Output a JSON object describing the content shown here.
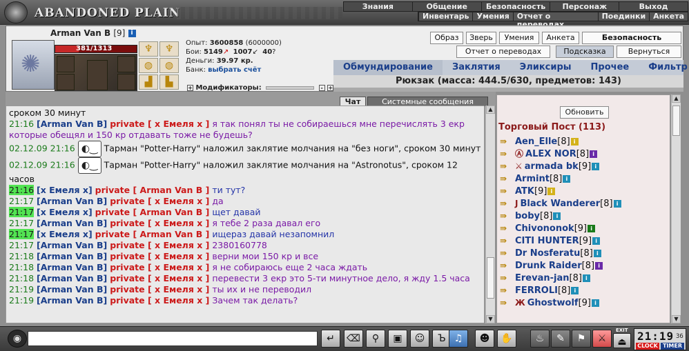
{
  "app": {
    "logo": "ABANDONED PLAIN"
  },
  "topnav": {
    "row1": [
      "Знания",
      "Общение",
      "Безопасность",
      "Персонаж",
      "Выход"
    ],
    "row2": [
      "Инвентарь",
      "Умения",
      "Отчет о переводах",
      "Поединки",
      "Анкета"
    ]
  },
  "character": {
    "name": "Arman Van B",
    "level": "[9]",
    "hp_text": "381/1313",
    "hp_fraction": 0.29,
    "stats": {
      "exp_label": "Опыт:",
      "exp_value": "3600858",
      "exp_next": "(6000000)",
      "fights_label": "Бои:",
      "wins": "5149",
      "losses": "1007",
      "draws": "40",
      "money_label": "Деньги:",
      "money_value": "39.97 кр.",
      "bank_label": "Банк:",
      "bank_link": "выбрать счёт"
    },
    "modifiers_label": "Модификаторы:"
  },
  "panel": {
    "buttons_row1": [
      "Образ",
      "Зверь",
      "Умения",
      "Анкета",
      "Безопасность"
    ],
    "buttons_row2": [
      "Отчет о переводах",
      "Подсказка",
      "Вернуться"
    ],
    "tabs": [
      "Обмундирование",
      "Заклятия",
      "Эликсиры",
      "Прочее",
      "Фильтр"
    ],
    "backpack": "Рюкзак (масса: 444.5/630, предметов: 143)"
  },
  "chat_tabs": {
    "chat": "Чат",
    "system": "Системные сообщения"
  },
  "chat": {
    "lines": [
      {
        "kind": "text",
        "text": "сроком 30 минут"
      },
      {
        "kind": "priv",
        "time": "21:16",
        "hl": false,
        "from": "[Arman Van B]",
        "to": "private [ x Емеля x ]",
        "msg": "я так понял ты не собираешься мне перечислять 3 екр которые обещял и 150 кр отдавать тоже не будешь?",
        "color": "purple"
      },
      {
        "kind": "sys",
        "date": "02.12.09 21:16",
        "text": "Тарман \"Potter-Harry\" наложил заклятие молчания на \"без ноги\", сроком 30 минут"
      },
      {
        "kind": "sys",
        "date": "02.12.09 21:16",
        "text": "Тарман \"Potter-Harry\" наложил заклятие молчания на \"Astronotus\", сроком 12 часов"
      },
      {
        "kind": "priv",
        "time": "21:16",
        "hl": true,
        "from": "[x Емеля x]",
        "to": "private [ Arman Van B ]",
        "msg": "ти тут?",
        "color": "blue"
      },
      {
        "kind": "priv",
        "time": "21:17",
        "hl": false,
        "from": "[Arman Van B]",
        "to": "private [ x Емеля x ]",
        "msg": "да",
        "color": "purple"
      },
      {
        "kind": "priv",
        "time": "21:17",
        "hl": true,
        "from": "[x Емеля x]",
        "to": "private [ Arman Van B ]",
        "msg": "щет давай",
        "color": "blue"
      },
      {
        "kind": "priv",
        "time": "21:17",
        "hl": false,
        "from": "[Arman Van B]",
        "to": "private [ x Емеля x ]",
        "msg": "я тебе 2 раза давал его",
        "color": "purple"
      },
      {
        "kind": "priv",
        "time": "21:17",
        "hl": true,
        "from": "[x Емеля x]",
        "to": "private [ Arman Van B ]",
        "msg": "ищераз давай незапомнил",
        "color": "blue"
      },
      {
        "kind": "priv",
        "time": "21:17",
        "hl": false,
        "from": "[Arman Van B]",
        "to": "private [ x Емеля x ]",
        "msg": "2380160778",
        "color": "purple"
      },
      {
        "kind": "priv",
        "time": "21:18",
        "hl": false,
        "from": "[Arman Van B]",
        "to": "private [ x Емеля x ]",
        "msg": "верни мои 150 кр и все",
        "color": "purple"
      },
      {
        "kind": "priv",
        "time": "21:18",
        "hl": false,
        "from": "[Arman Van B]",
        "to": "private [ x Емеля x ]",
        "msg": "я не собираюсь еще 2 часа ждать",
        "color": "purple"
      },
      {
        "kind": "priv",
        "time": "21:18",
        "hl": false,
        "from": "[Arman Van B]",
        "to": "private [ x Емеля x ]",
        "msg": "перевести 3 екр это 5-ти минутное дело, я жду 1.5 часа",
        "color": "purple"
      },
      {
        "kind": "priv",
        "time": "21:19",
        "hl": false,
        "from": "[Arman Van B]",
        "to": "private [ x Емеля x ]",
        "msg": "ты их и не переводил",
        "color": "purple"
      },
      {
        "kind": "priv",
        "time": "21:19",
        "hl": false,
        "from": "[Arman Van B]",
        "to": "private [ x Емеля x ]",
        "msg": "Зачем так делать?",
        "color": "purple"
      }
    ]
  },
  "room": {
    "refresh": "Обновить",
    "title": "Торговый Пост (113)",
    "users": [
      {
        "name": "Aen_Elle",
        "lvl": "[8]",
        "info": "#d4b21a"
      },
      {
        "name": "ALEX NOR",
        "lvl": "[8]",
        "info": "#6a2aa8",
        "badge": "Ⓐ"
      },
      {
        "name": "armada bk",
        "lvl": "[9]",
        "info": "#1f8fb8",
        "badge": "⚔"
      },
      {
        "name": "Armint",
        "lvl": "[8]",
        "info": "#1f8fb8"
      },
      {
        "name": "ATK",
        "lvl": "[9]",
        "info": "#d4b21a"
      },
      {
        "name": "Black Wanderer",
        "lvl": "[8]",
        "info": "#1f8fb8",
        "badge": "J"
      },
      {
        "name": "boby",
        "lvl": "[8]",
        "info": "#1f8fb8"
      },
      {
        "name": "Chivononok",
        "lvl": "[9]",
        "info": "#1a7a1a"
      },
      {
        "name": "CITI HUNTER",
        "lvl": "[9]",
        "info": "#1f8fb8"
      },
      {
        "name": "Dr Nosferatu",
        "lvl": "[8]",
        "info": "#1f8fb8"
      },
      {
        "name": "Drunk Raider",
        "lvl": "[8]",
        "info": "#6a2aa8"
      },
      {
        "name": "Erevan-jan",
        "lvl": "[8]",
        "info": "#1f8fb8"
      },
      {
        "name": "FERROLI",
        "lvl": "[8]",
        "info": "#1f8fb8"
      },
      {
        "name": "Ghostwolf",
        "lvl": "[9]",
        "info": "#1f8fb8",
        "badge": "Ж"
      }
    ]
  },
  "bottombar": {
    "input_placeholder": "",
    "clock_time": "21:19",
    "clock_sec": "36",
    "clock_label": "CLOCK",
    "timer_label": "TIMER",
    "exit_label": "EXIT"
  },
  "colors": {
    "nick_blue": "#1a3e8a",
    "private_red": "#cc1a1a",
    "msg_purple": "#7a1aa6",
    "time_green": "#1a7a1a",
    "highlight_green": "#52e452"
  }
}
